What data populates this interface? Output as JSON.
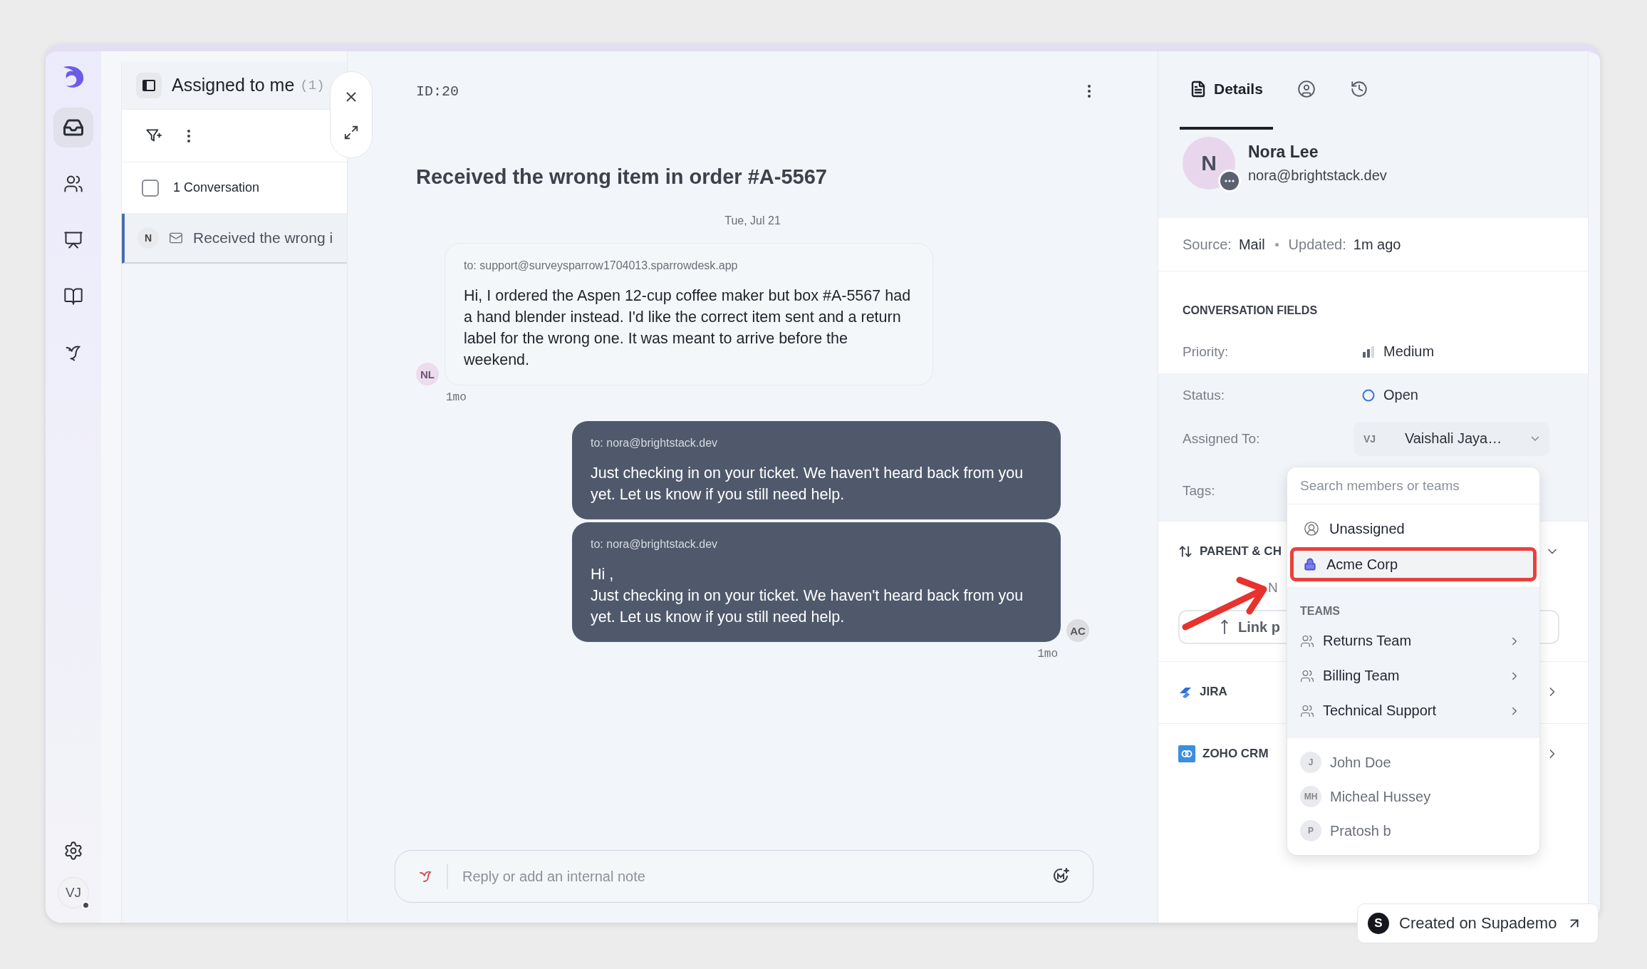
{
  "rail": {
    "items": [
      {
        "kind": "inbox",
        "selected": true
      },
      {
        "kind": "contacts",
        "selected": false
      },
      {
        "kind": "reports",
        "selected": false
      },
      {
        "kind": "knowledge",
        "selected": false
      },
      {
        "kind": "bot",
        "selected": false
      }
    ],
    "user_initials": "VJ"
  },
  "list": {
    "title": "Assigned to me",
    "count": "(1)",
    "summary": "1 Conversation",
    "select_all_checked": false,
    "conversations": [
      {
        "initial": "N",
        "subject": "Received the wrong i",
        "selected": true
      }
    ]
  },
  "conversation": {
    "id": "ID:20",
    "title": "Received the wrong item in order #A-5567",
    "date": "Tue, Jul 21",
    "messages": [
      {
        "kind": "incoming",
        "to": "to: support@surveysparrow1704013.sparrowdesk.app",
        "body": [
          "Hi, I ordered the Aspen 12-cup coffee maker but box #A-5567 had a hand blender instead. I'd like the correct item sent and a return label for the wrong one. It was meant to arrive before the weekend."
        ],
        "avatar": "NL",
        "time": "1mo"
      },
      {
        "kind": "outgoing",
        "to": "to: nora@brightstack.dev",
        "body": [
          "Just checking in on your ticket. We haven't heard back from you yet. Let us know if you still need help."
        ]
      },
      {
        "kind": "outgoing",
        "to": "to: nora@brightstack.dev",
        "body": [
          "Hi ,",
          "Just checking in on your ticket. We haven't heard back from you yet. Let us know if you still need help."
        ],
        "avatar": "AC",
        "time": "1mo"
      }
    ],
    "composer": {
      "placeholder": "Reply or add an internal note"
    }
  },
  "details": {
    "tabs": [
      {
        "kind": "details",
        "label": "Details",
        "selected": true
      },
      {
        "kind": "profile",
        "selected": false
      },
      {
        "kind": "history",
        "selected": false
      }
    ],
    "contact": {
      "initial": "N",
      "name": "Nora Lee",
      "email": "nora@brightstack.dev"
    },
    "source_label": "Source:",
    "source": "Mail",
    "updated_label": "Updated:",
    "updated": "1m ago",
    "fields_heading": "CONVERSATION FIELDS",
    "fields": [
      {
        "kind": "priority",
        "label": "Priority:",
        "value": "Medium"
      },
      {
        "kind": "status",
        "label": "Status:",
        "value": "Open"
      },
      {
        "kind": "assignee",
        "label": "Assigned To:",
        "initials": "VJ",
        "value": "Vaishali Jaya…"
      },
      {
        "kind": "tags",
        "label": "Tags:"
      }
    ],
    "sections": [
      {
        "kind": "parent",
        "title": "PARENT & CH",
        "empty_text": "N",
        "button": "Link p",
        "expanded": true
      },
      {
        "kind": "jira",
        "title": "JIRA",
        "expanded": false
      },
      {
        "kind": "zoho",
        "title": "ZOHO CRM",
        "expanded": false
      }
    ]
  },
  "assign_menu": {
    "placeholder": "Search members or teams",
    "options": [
      {
        "kind": "unassigned",
        "label": "Unassigned",
        "highlighted": false
      },
      {
        "kind": "company",
        "label": "Acme Corp",
        "highlighted": true
      }
    ],
    "teams_heading": "TEAMS",
    "teams": [
      {
        "name": "Returns Team"
      },
      {
        "name": "Billing Team"
      },
      {
        "name": "Technical Support"
      }
    ],
    "members": [
      {
        "initials": "J",
        "name": "John Doe"
      },
      {
        "initials": "MH",
        "name": "Micheal Hussey"
      },
      {
        "initials": "P",
        "name": "Pratosh b"
      }
    ]
  },
  "badge": {
    "initial": "S",
    "label": "Created on Supademo"
  }
}
